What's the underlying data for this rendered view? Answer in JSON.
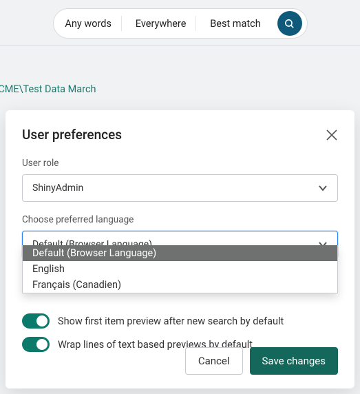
{
  "search": {
    "seg_words": "Any words",
    "seg_where": "Everywhere",
    "seg_match": "Best match"
  },
  "breadcrumb": "ents\\ACME\\Test Data March",
  "modal": {
    "title": "User preferences",
    "role_label": "User role",
    "role_value": "ShinyAdmin",
    "lang_label": "Choose preferred language",
    "lang_value": "Default (Browser Language)",
    "lang_options": [
      "Default (Browser Language)",
      "English",
      "Français (Canadien)"
    ],
    "toggles": {
      "preview": {
        "label": "Show first item preview after new search by default",
        "on": true
      },
      "wrap": {
        "label": "Wrap lines of text based previews by default",
        "on": true
      }
    },
    "cancel": "Cancel",
    "save": "Save changes"
  }
}
